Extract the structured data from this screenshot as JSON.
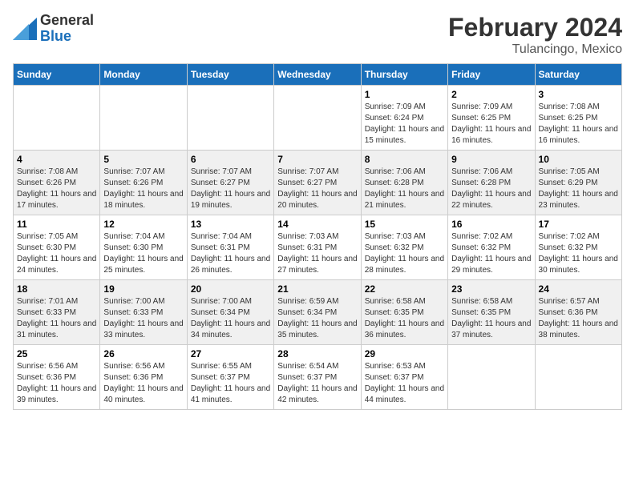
{
  "logo": {
    "general": "General",
    "blue": "Blue"
  },
  "title": "February 2024",
  "location": "Tulancingo, Mexico",
  "days_of_week": [
    "Sunday",
    "Monday",
    "Tuesday",
    "Wednesday",
    "Thursday",
    "Friday",
    "Saturday"
  ],
  "weeks": [
    [
      {
        "day": "",
        "info": ""
      },
      {
        "day": "",
        "info": ""
      },
      {
        "day": "",
        "info": ""
      },
      {
        "day": "",
        "info": ""
      },
      {
        "day": "1",
        "info": "Sunrise: 7:09 AM\nSunset: 6:24 PM\nDaylight: 11 hours and 15 minutes."
      },
      {
        "day": "2",
        "info": "Sunrise: 7:09 AM\nSunset: 6:25 PM\nDaylight: 11 hours and 16 minutes."
      },
      {
        "day": "3",
        "info": "Sunrise: 7:08 AM\nSunset: 6:25 PM\nDaylight: 11 hours and 16 minutes."
      }
    ],
    [
      {
        "day": "4",
        "info": "Sunrise: 7:08 AM\nSunset: 6:26 PM\nDaylight: 11 hours and 17 minutes."
      },
      {
        "day": "5",
        "info": "Sunrise: 7:07 AM\nSunset: 6:26 PM\nDaylight: 11 hours and 18 minutes."
      },
      {
        "day": "6",
        "info": "Sunrise: 7:07 AM\nSunset: 6:27 PM\nDaylight: 11 hours and 19 minutes."
      },
      {
        "day": "7",
        "info": "Sunrise: 7:07 AM\nSunset: 6:27 PM\nDaylight: 11 hours and 20 minutes."
      },
      {
        "day": "8",
        "info": "Sunrise: 7:06 AM\nSunset: 6:28 PM\nDaylight: 11 hours and 21 minutes."
      },
      {
        "day": "9",
        "info": "Sunrise: 7:06 AM\nSunset: 6:28 PM\nDaylight: 11 hours and 22 minutes."
      },
      {
        "day": "10",
        "info": "Sunrise: 7:05 AM\nSunset: 6:29 PM\nDaylight: 11 hours and 23 minutes."
      }
    ],
    [
      {
        "day": "11",
        "info": "Sunrise: 7:05 AM\nSunset: 6:30 PM\nDaylight: 11 hours and 24 minutes."
      },
      {
        "day": "12",
        "info": "Sunrise: 7:04 AM\nSunset: 6:30 PM\nDaylight: 11 hours and 25 minutes."
      },
      {
        "day": "13",
        "info": "Sunrise: 7:04 AM\nSunset: 6:31 PM\nDaylight: 11 hours and 26 minutes."
      },
      {
        "day": "14",
        "info": "Sunrise: 7:03 AM\nSunset: 6:31 PM\nDaylight: 11 hours and 27 minutes."
      },
      {
        "day": "15",
        "info": "Sunrise: 7:03 AM\nSunset: 6:32 PM\nDaylight: 11 hours and 28 minutes."
      },
      {
        "day": "16",
        "info": "Sunrise: 7:02 AM\nSunset: 6:32 PM\nDaylight: 11 hours and 29 minutes."
      },
      {
        "day": "17",
        "info": "Sunrise: 7:02 AM\nSunset: 6:32 PM\nDaylight: 11 hours and 30 minutes."
      }
    ],
    [
      {
        "day": "18",
        "info": "Sunrise: 7:01 AM\nSunset: 6:33 PM\nDaylight: 11 hours and 31 minutes."
      },
      {
        "day": "19",
        "info": "Sunrise: 7:00 AM\nSunset: 6:33 PM\nDaylight: 11 hours and 33 minutes."
      },
      {
        "day": "20",
        "info": "Sunrise: 7:00 AM\nSunset: 6:34 PM\nDaylight: 11 hours and 34 minutes."
      },
      {
        "day": "21",
        "info": "Sunrise: 6:59 AM\nSunset: 6:34 PM\nDaylight: 11 hours and 35 minutes."
      },
      {
        "day": "22",
        "info": "Sunrise: 6:58 AM\nSunset: 6:35 PM\nDaylight: 11 hours and 36 minutes."
      },
      {
        "day": "23",
        "info": "Sunrise: 6:58 AM\nSunset: 6:35 PM\nDaylight: 11 hours and 37 minutes."
      },
      {
        "day": "24",
        "info": "Sunrise: 6:57 AM\nSunset: 6:36 PM\nDaylight: 11 hours and 38 minutes."
      }
    ],
    [
      {
        "day": "25",
        "info": "Sunrise: 6:56 AM\nSunset: 6:36 PM\nDaylight: 11 hours and 39 minutes."
      },
      {
        "day": "26",
        "info": "Sunrise: 6:56 AM\nSunset: 6:36 PM\nDaylight: 11 hours and 40 minutes."
      },
      {
        "day": "27",
        "info": "Sunrise: 6:55 AM\nSunset: 6:37 PM\nDaylight: 11 hours and 41 minutes."
      },
      {
        "day": "28",
        "info": "Sunrise: 6:54 AM\nSunset: 6:37 PM\nDaylight: 11 hours and 42 minutes."
      },
      {
        "day": "29",
        "info": "Sunrise: 6:53 AM\nSunset: 6:37 PM\nDaylight: 11 hours and 44 minutes."
      },
      {
        "day": "",
        "info": ""
      },
      {
        "day": "",
        "info": ""
      }
    ]
  ]
}
